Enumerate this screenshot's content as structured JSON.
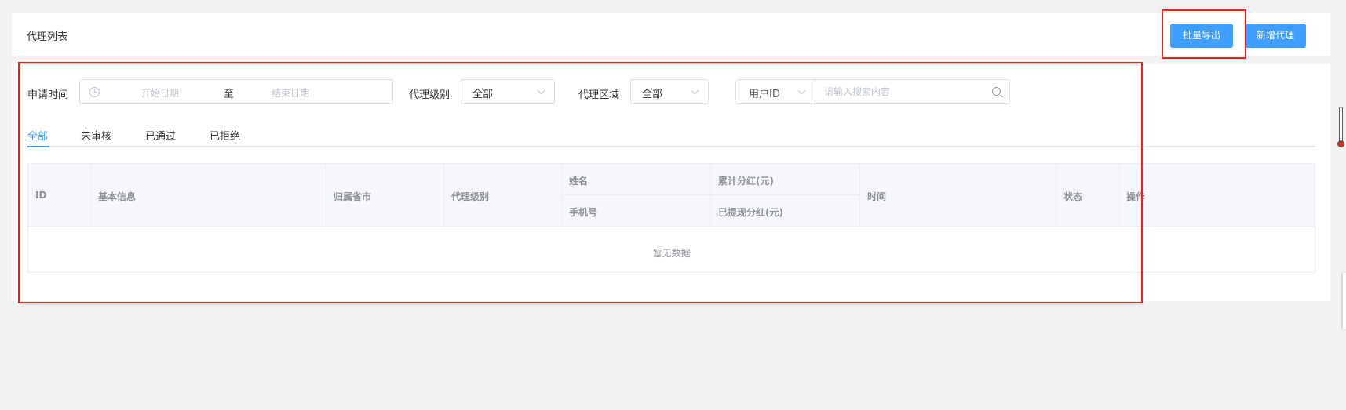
{
  "header": {
    "title": "代理列表",
    "export_label": "批量导出",
    "add_label": "新增代理"
  },
  "filters": {
    "apply_time_label": "申请时间",
    "start_placeholder": "开始日期",
    "range_separator": "至",
    "end_placeholder": "结束日期",
    "level_label": "代理级别",
    "level_value": "全部",
    "region_label": "代理区域",
    "region_value": "全部",
    "search_type_value": "用户ID",
    "search_placeholder": "请输入搜索内容"
  },
  "tabs": [
    {
      "label": "全部",
      "active": true
    },
    {
      "label": "未审核",
      "active": false
    },
    {
      "label": "已通过",
      "active": false
    },
    {
      "label": "已拒绝",
      "active": false
    }
  ],
  "table": {
    "columns": {
      "id": "ID",
      "basic_info": "基本信息",
      "province_city": "归属省市",
      "agent_level": "代理级别",
      "name": "姓名",
      "phone": "手机号",
      "total_dividend": "累计分红(元)",
      "withdrawn_dividend": "已提现分红(元)",
      "time": "时间",
      "status": "状态",
      "actions": "操作"
    },
    "empty_text": "暂无数据"
  },
  "colors": {
    "primary": "#409eff",
    "highlight_box": "#ff1a1a",
    "page_background": "#f2f2f2"
  }
}
